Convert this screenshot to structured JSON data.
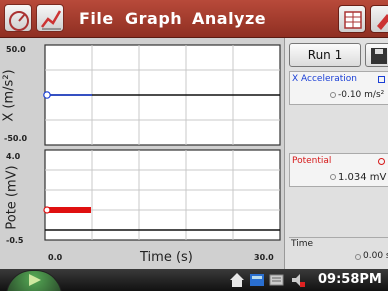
{
  "menu": {
    "file": "File",
    "graph": "Graph",
    "analyze": "Analyze"
  },
  "graph_top": {
    "y_max": "50.0",
    "y_min": "-50.0",
    "y_label": "X (m/s²)"
  },
  "graph_bottom": {
    "y_max": "4.0",
    "y_min": "-0.5",
    "y_label": "Pote (mV)",
    "x_min": "0.0",
    "x_max": "30.0",
    "x_label": "Time (s)"
  },
  "run": {
    "label": "Run 1"
  },
  "meters": {
    "acceleration": {
      "label": "X Acceleration",
      "value": "-0.10 m/s²",
      "color": "#1a3fd6"
    },
    "potential": {
      "label": "Potential",
      "value": "1.034 mV",
      "color": "#d61a1a"
    },
    "time": {
      "label": "Time",
      "value": "0.00 s"
    }
  },
  "status": {
    "clock": "09:58PM"
  }
}
